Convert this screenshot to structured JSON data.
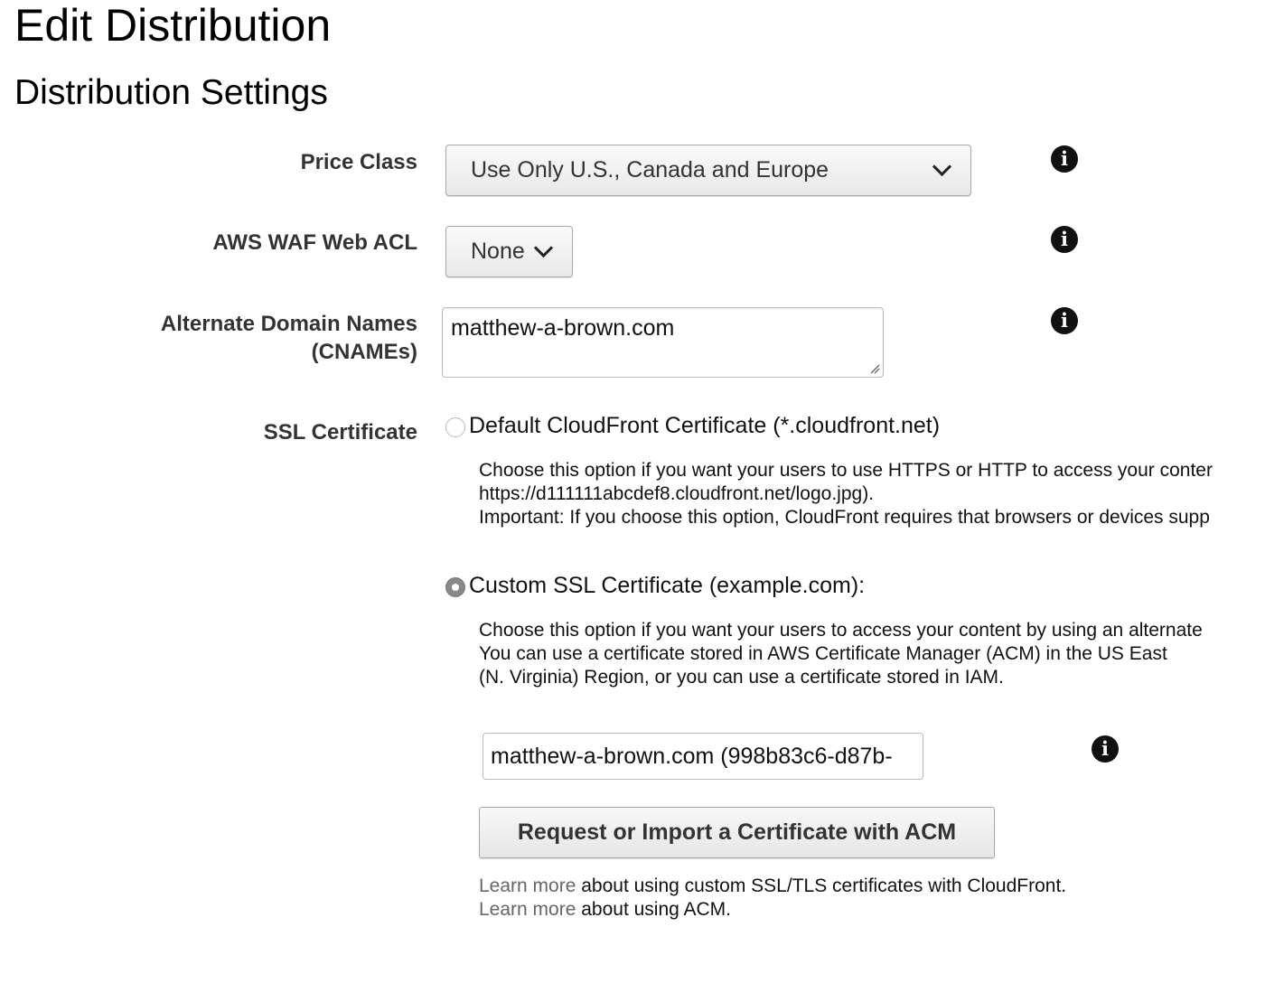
{
  "page": {
    "title": "Edit Distribution",
    "section_title": "Distribution Settings"
  },
  "price_class": {
    "label": "Price Class",
    "selected": "Use Only U.S., Canada and Europe"
  },
  "waf": {
    "label": "AWS WAF Web ACL",
    "selected": "None"
  },
  "cnames": {
    "label_line1": "Alternate Domain Names",
    "label_line2": "(CNAMEs)",
    "value": "matthew-a-brown.com"
  },
  "ssl": {
    "label": "SSL Certificate",
    "default_option": {
      "label": "Default CloudFront Certificate (*.cloudfront.net)",
      "selected": false,
      "desc_line1": "Choose this option if you want your users to use HTTPS or HTTP to access your conter",
      "desc_line2": "https://d111111abcdef8.cloudfront.net/logo.jpg).",
      "desc_line3": "Important: If you choose this option, CloudFront requires that browsers or devices supp"
    },
    "custom_option": {
      "label": "Custom SSL Certificate (example.com):",
      "selected": true,
      "desc_line1": "Choose this option if you want your users to access your content by using an alternate",
      "desc_line2": "You can use a certificate stored in AWS Certificate Manager (ACM) in the US East",
      "desc_line3": "(N. Virginia) Region, or you can use a certificate stored in IAM."
    },
    "certificate_value": "matthew-a-brown.com (998b83c6-d87b-",
    "acm_button": "Request or Import a Certificate with ACM",
    "learn_more_1": {
      "link": "Learn more",
      "text": " about using custom SSL/TLS certificates with CloudFront."
    },
    "learn_more_2": {
      "link": "Learn more",
      "text": " about using ACM."
    }
  },
  "icons": {
    "info_glyph": "i",
    "info_icon_name": "info-icon"
  }
}
